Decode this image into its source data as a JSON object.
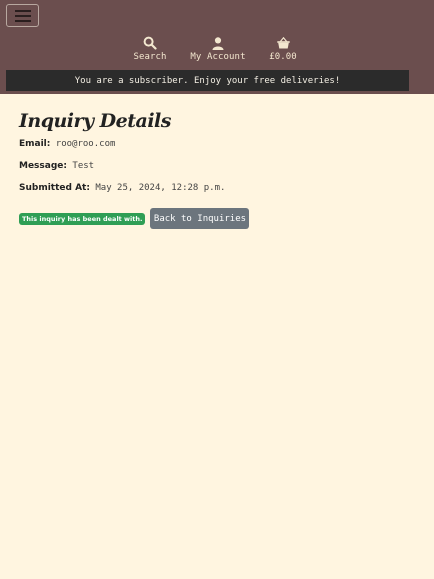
{
  "nav": {
    "search_label": "Search",
    "account_label": "My Account",
    "bag_total": "£0.00",
    "icons": [
      "menu-icon",
      "search-icon",
      "user-icon",
      "shopping-basket-icon"
    ],
    "accent_color": "#6b4e4e"
  },
  "banner": {
    "text": "You are a subscriber. Enjoy your free deliveries!"
  },
  "page": {
    "title": "Inquiry Details",
    "email_key": "Email:",
    "email_value": "roo@roo.com",
    "message_key": "Message:",
    "message_value": "Test",
    "submitted_key": "Submitted At:",
    "submitted_value": "May 25, 2024, 12:28 p.m.",
    "status_badge": "This inquiry has been dealt with.",
    "back_button": "Back to Inquiries",
    "badge_color": "#2f9e55",
    "button_color": "#6c757d"
  }
}
